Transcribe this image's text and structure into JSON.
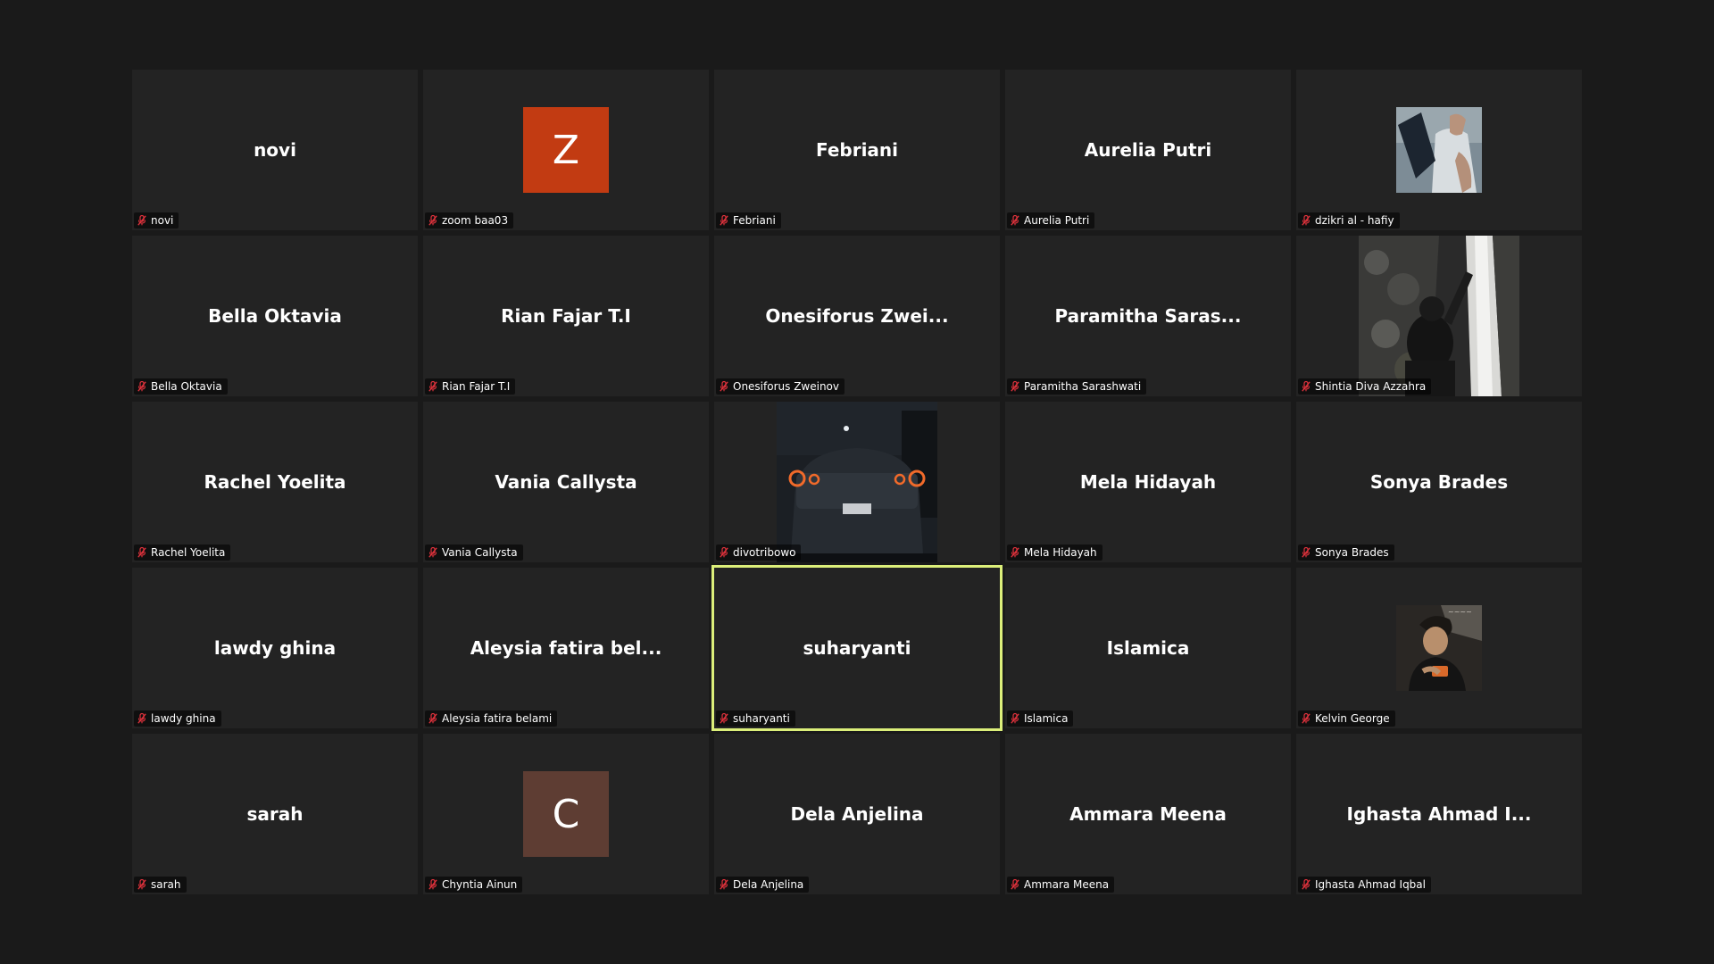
{
  "colors": {
    "background": "#1a1a1a",
    "tile": "#232323",
    "active_speaker_border": "#dcef7a",
    "muted_icon": "#e0323c",
    "avatar_z": "#c23b12",
    "avatar_c": "#5e3d33"
  },
  "participants": [
    {
      "display": "novi",
      "label": "novi",
      "muted": true
    },
    {
      "display": "",
      "label": "zoom baa03",
      "muted": true,
      "avatar_letter": "Z"
    },
    {
      "display": "Febriani",
      "label": "Febriani",
      "muted": true
    },
    {
      "display": "Aurelia Putri",
      "label": "Aurelia Putri",
      "muted": true
    },
    {
      "display": "",
      "label": "dzikri al - hafiy",
      "muted": true,
      "photo": "profile-photo"
    },
    {
      "display": "Bella Oktavia",
      "label": "Bella Oktavia",
      "muted": true
    },
    {
      "display": "Rian Fajar T.I",
      "label": "Rian Fajar T.I",
      "muted": true
    },
    {
      "display": "Onesiforus Zwei...",
      "label": "Onesiforus Zweinov",
      "muted": true
    },
    {
      "display": "Paramitha Saras...",
      "label": "Paramitha Sarashwati",
      "muted": true
    },
    {
      "display": "",
      "label": "Shintia Diva Azzahra",
      "muted": true,
      "photo": "video-waterfall"
    },
    {
      "display": "Rachel Yoelita",
      "label": "Rachel Yoelita",
      "muted": true
    },
    {
      "display": "Vania Callysta",
      "label": "Vania Callysta",
      "muted": true
    },
    {
      "display": "",
      "label": "divotribowo",
      "muted": true,
      "photo": "video-car"
    },
    {
      "display": "Mela Hidayah",
      "label": "Mela Hidayah",
      "muted": true
    },
    {
      "display": "Sonya Brades",
      "label": "Sonya Brades",
      "muted": true
    },
    {
      "display": "lawdy ghina",
      "label": "lawdy ghina",
      "muted": true
    },
    {
      "display": "Aleysia fatira bel...",
      "label": "Aleysia fatira belami",
      "muted": true
    },
    {
      "display": "suharyanti",
      "label": "suharyanti",
      "muted": true,
      "active_speaker": true
    },
    {
      "display": "Islamica",
      "label": "Islamica",
      "muted": true
    },
    {
      "display": "",
      "label": "Kelvin George",
      "muted": true,
      "photo": "profile-photo"
    },
    {
      "display": "sarah",
      "label": "sarah",
      "muted": true
    },
    {
      "display": "",
      "label": "Chyntia Ainun",
      "muted": true,
      "avatar_letter": "C"
    },
    {
      "display": "Dela Anjelina",
      "label": "Dela Anjelina",
      "muted": true
    },
    {
      "display": "Ammara Meena",
      "label": "Ammara Meena",
      "muted": true
    },
    {
      "display": "Ighasta Ahmad I...",
      "label": "Ighasta Ahmad Iqbal",
      "muted": true
    }
  ]
}
